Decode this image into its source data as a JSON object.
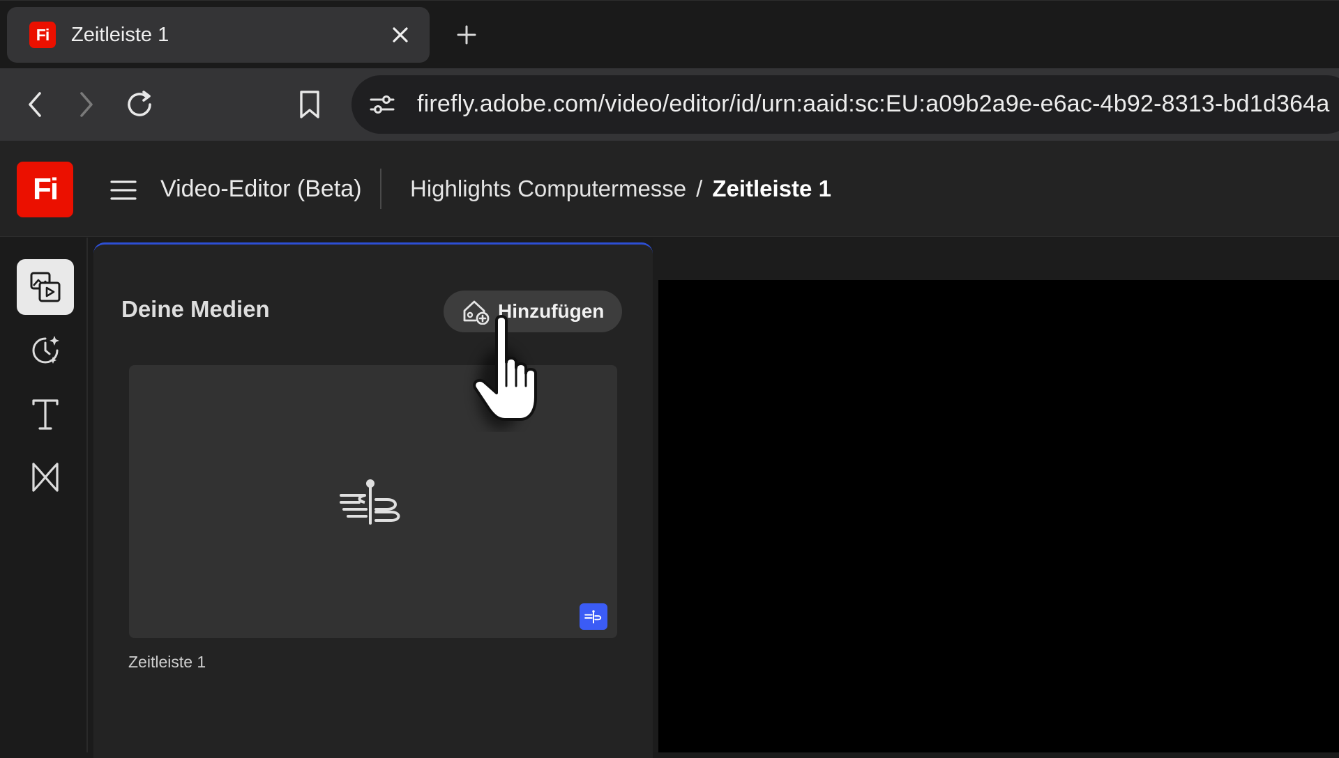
{
  "browser": {
    "tab": {
      "favicon_text": "Fi",
      "title": "Zeitleiste 1"
    },
    "url": "firefly.adobe.com/video/editor/id/urn:aaid:sc:EU:a09b2a9e-e6ac-4b92-8313-bd1d364a"
  },
  "app": {
    "logo_text": "Fi",
    "title": "Video-Editor (Beta)",
    "breadcrumb": {
      "project": "Highlights Computermesse",
      "separator": "/",
      "current": "Zeitleiste 1"
    }
  },
  "rail": {
    "items": [
      {
        "name": "media-icon",
        "active": true
      },
      {
        "name": "generate-icon",
        "active": false
      },
      {
        "name": "text-icon",
        "active": false
      },
      {
        "name": "transitions-icon",
        "active": false
      }
    ]
  },
  "media_panel": {
    "title": "Deine Medien",
    "add_button_label": "Hinzufügen",
    "items": [
      {
        "name": "Zeitleiste 1"
      }
    ]
  },
  "colors": {
    "accent_blue": "#3b5cf6",
    "brand_red": "#eb1000",
    "panel_border": "#2d4fd4"
  }
}
